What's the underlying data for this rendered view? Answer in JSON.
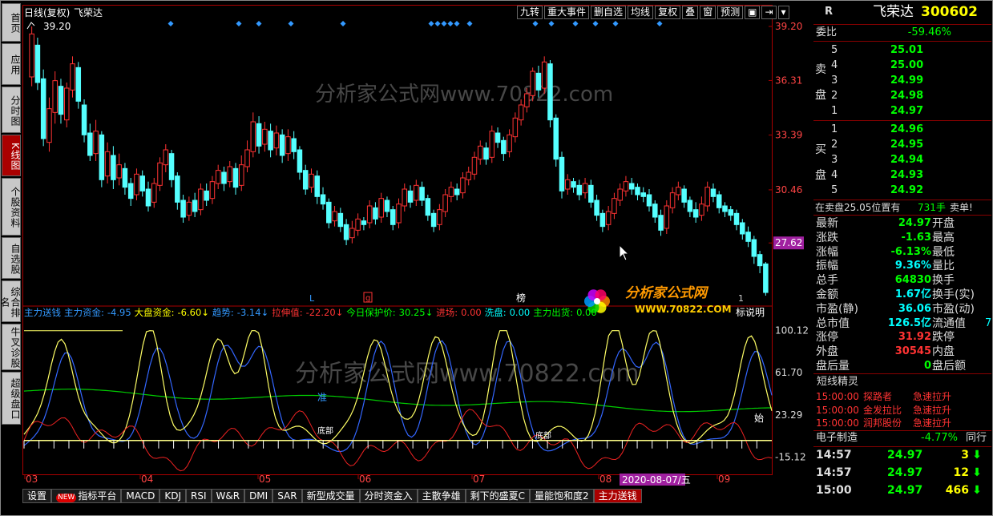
{
  "nav": {
    "items": [
      "首页",
      "应用",
      "分时图",
      "K线图",
      "个股资料",
      "自选股",
      "综合排名",
      "牛叉诊股",
      "超级盘口"
    ]
  },
  "chart_header": {
    "period": "日线(复权)",
    "name": "飞荣达",
    "marker": "39.20"
  },
  "top_buttons": [
    "九转",
    "重大事件",
    "删自选",
    "均线",
    "复权",
    "叠",
    "窗",
    "预测",
    "▣",
    "⇥",
    "▾"
  ],
  "price_axis": [
    "39.20",
    "36.31",
    "33.39",
    "30.46",
    "27.62"
  ],
  "price_tag": "27.62",
  "indicator_axis": [
    "100.12",
    "61.70",
    "23.29",
    "-15.12"
  ],
  "indicator_header": [
    {
      "t": "主力送钱",
      "c": "#39f"
    },
    {
      "t": "主力资金:",
      "c": "#39f"
    },
    {
      "t": "-4.95",
      "c": "#39f"
    },
    {
      "t": "大盘资金:",
      "c": "#ff0"
    },
    {
      "t": "-6.60↓",
      "c": "#ff0"
    },
    {
      "t": "趋势:",
      "c": "#39f"
    },
    {
      "t": "-3.14↓",
      "c": "#39f"
    },
    {
      "t": "拉伸值:",
      "c": "#f33"
    },
    {
      "t": "-22.20↓",
      "c": "#f33"
    },
    {
      "t": "今日保护价:",
      "c": "#0f0"
    },
    {
      "t": "30.25↓",
      "c": "#0f0"
    },
    {
      "t": "进场:",
      "c": "#f33"
    },
    {
      "t": "0.00",
      "c": "#f33"
    },
    {
      "t": "洗盘:",
      "c": "#0ff"
    },
    {
      "t": "0.00",
      "c": "#0ff"
    },
    {
      "t": "主力出货:",
      "c": "#0f0"
    },
    {
      "t": "0.00",
      "c": "#0f0"
    }
  ],
  "indicator_note": "标说明",
  "x_axis": {
    "months": [
      "03",
      "04",
      "05",
      "06",
      "07",
      "08",
      "09"
    ],
    "date_label": "2020-08-07/五"
  },
  "price_markers": {
    "L": "L",
    "g": "g",
    "rank": "榜",
    "count": "1"
  },
  "indicator_labels": {
    "zhun": "准",
    "shi": "始",
    "dibu": "底部"
  },
  "watermark": {
    "main": "分析家公式网www.70822.com",
    "logo": "分析家公式网",
    "logo_url": "WWW.70822.COM"
  },
  "tabs": [
    "设置",
    "指标平台",
    "MACD",
    "KDJ",
    "RSI",
    "W&R",
    "DMI",
    "SAR",
    "新型成交量",
    "分时资金入",
    "主散争雄",
    "剩下的盛夏C",
    "量能饱和度2",
    "主力送钱"
  ],
  "tabs_new": "NEW",
  "active_tab": "主力送钱",
  "quote": {
    "r": "R",
    "name": "飞荣达",
    "code": "300602",
    "weibi_label": "委比",
    "weibi": "-59.46%",
    "sell_label": [
      "卖",
      "盘"
    ],
    "sells": [
      [
        "5",
        "25.01"
      ],
      [
        "4",
        "25.00"
      ],
      [
        "3",
        "24.99"
      ],
      [
        "2",
        "24.98"
      ],
      [
        "1",
        "24.97"
      ]
    ],
    "buy_label": [
      "买",
      "盘"
    ],
    "buys": [
      [
        "1",
        "24.96"
      ],
      [
        "2",
        "24.95"
      ],
      [
        "3",
        "24.94"
      ],
      [
        "4",
        "24.93"
      ],
      [
        "5",
        "24.92"
      ]
    ],
    "notice": "在卖盘25.05位置有",
    "notice_vol": "731手",
    "notice_tail": "卖单!",
    "stats": [
      [
        "最新",
        "24.97",
        "开盘",
        ""
      ],
      [
        "涨跌",
        "-1.63",
        "最高",
        ""
      ],
      [
        "涨幅",
        "-6.13%",
        "最低",
        ""
      ],
      [
        "振幅",
        "9.36%",
        "量比",
        ""
      ],
      [
        "总手",
        "64830",
        "换手",
        ""
      ],
      [
        "金额",
        "1.67亿",
        "换手(实)",
        ""
      ],
      [
        "市盈(静)",
        "36.06",
        "市盈(动)",
        ""
      ],
      [
        "总市值",
        "126.5亿",
        "流通值",
        "7"
      ],
      [
        "涨停",
        "31.92",
        "跌停",
        ""
      ],
      [
        "外盘",
        "30545",
        "内盘",
        ""
      ],
      [
        "盘后量",
        "0",
        "盘后额",
        ""
      ]
    ],
    "sprite_title": "短线精灵",
    "sprites": [
      [
        "15:00:00",
        "探路者",
        "急速拉升"
      ],
      [
        "15:00:00",
        "金发拉比",
        "急速拉升"
      ],
      [
        "15:00:00",
        "润邦股份",
        "急速拉升"
      ]
    ],
    "sector": "电子制造",
    "sector_pct": "-4.77%",
    "sector_more": "同行",
    "ticks": [
      [
        "14:57",
        "24.97",
        "3"
      ],
      [
        "14:57",
        "24.97",
        "12"
      ],
      [
        "15:00",
        "24.97",
        "466"
      ]
    ]
  },
  "chart_data": {
    "type": "candlestick",
    "title": "飞荣达",
    "ylim": [
      24.5,
      39.5
    ],
    "x_months": [
      "03",
      "04",
      "05",
      "06",
      "07",
      "08",
      "09"
    ],
    "candles": [
      [
        36.5,
        38.8,
        36.0,
        39.2
      ],
      [
        38.2,
        36.2,
        35.8,
        38.6
      ],
      [
        36.4,
        33.2,
        32.8,
        36.9
      ],
      [
        33.0,
        34.8,
        32.5,
        35.4
      ],
      [
        34.6,
        36.3,
        34.0,
        36.8
      ],
      [
        36.0,
        34.5,
        34.0,
        36.4
      ],
      [
        34.2,
        35.9,
        33.8,
        36.2
      ],
      [
        35.8,
        37.2,
        35.4,
        37.6
      ],
      [
        37.0,
        35.2,
        34.8,
        37.3
      ],
      [
        35.0,
        33.4,
        33.0,
        35.3
      ],
      [
        33.5,
        32.3,
        32.0,
        34.0
      ],
      [
        32.4,
        33.6,
        32.0,
        34.2
      ],
      [
        33.4,
        31.0,
        30.6,
        33.6
      ],
      [
        31.2,
        32.5,
        30.8,
        33.0
      ],
      [
        32.3,
        31.0,
        30.5,
        32.8
      ],
      [
        31.1,
        31.8,
        30.7,
        32.4
      ],
      [
        31.6,
        30.6,
        30.2,
        31.9
      ],
      [
        30.8,
        30.0,
        29.6,
        31.1
      ],
      [
        30.2,
        31.3,
        29.9,
        31.6
      ],
      [
        31.2,
        30.4,
        30.1,
        31.5
      ],
      [
        30.5,
        29.6,
        29.3,
        30.9
      ],
      [
        29.8,
        30.8,
        29.5,
        31.1
      ],
      [
        30.7,
        31.9,
        30.4,
        32.2
      ],
      [
        31.8,
        32.6,
        31.4,
        32.9
      ],
      [
        32.4,
        31.0,
        30.6,
        32.6
      ],
      [
        31.2,
        29.8,
        29.4,
        31.4
      ],
      [
        29.9,
        29.0,
        28.7,
        30.2
      ],
      [
        29.1,
        29.8,
        28.8,
        30.1
      ],
      [
        29.9,
        29.3,
        29.0,
        30.3
      ],
      [
        29.4,
        30.5,
        29.1,
        30.8
      ],
      [
        30.4,
        29.9,
        29.6,
        30.8
      ],
      [
        30.0,
        30.9,
        29.7,
        31.2
      ],
      [
        30.8,
        31.5,
        30.5,
        31.8
      ],
      [
        31.4,
        30.8,
        30.4,
        31.7
      ],
      [
        30.9,
        31.7,
        30.6,
        32.0
      ],
      [
        31.6,
        30.6,
        30.2,
        31.9
      ],
      [
        30.7,
        31.8,
        30.4,
        32.3
      ],
      [
        31.7,
        32.6,
        31.4,
        33.1
      ],
      [
        32.5,
        34.1,
        32.2,
        34.6
      ],
      [
        34.0,
        32.8,
        32.4,
        34.4
      ],
      [
        32.9,
        33.7,
        32.5,
        34.1
      ],
      [
        33.6,
        32.6,
        32.2,
        34.0
      ],
      [
        32.7,
        33.5,
        32.3,
        33.9
      ],
      [
        33.4,
        32.3,
        31.9,
        33.7
      ],
      [
        32.4,
        33.3,
        32.0,
        33.7
      ],
      [
        33.2,
        32.5,
        32.1,
        33.6
      ],
      [
        32.6,
        31.4,
        31.0,
        32.8
      ],
      [
        31.5,
        30.5,
        30.2,
        31.8
      ],
      [
        30.6,
        31.3,
        30.3,
        31.6
      ],
      [
        31.2,
        30.1,
        29.7,
        31.5
      ],
      [
        30.2,
        29.7,
        29.4,
        30.6
      ],
      [
        29.8,
        28.7,
        28.4,
        30.0
      ],
      [
        28.8,
        29.3,
        28.5,
        29.6
      ],
      [
        29.2,
        28.5,
        28.2,
        29.5
      ],
      [
        28.6,
        27.8,
        27.5,
        28.9
      ],
      [
        27.9,
        28.4,
        27.6,
        28.8
      ],
      [
        28.3,
        28.9,
        28.0,
        29.2
      ],
      [
        28.8,
        28.6,
        28.3,
        29.0
      ],
      [
        28.7,
        29.6,
        28.4,
        29.9
      ],
      [
        29.5,
        28.9,
        28.6,
        29.8
      ],
      [
        29.0,
        30.0,
        28.7,
        30.3
      ],
      [
        29.9,
        29.3,
        29.0,
        30.1
      ],
      [
        29.4,
        28.6,
        28.3,
        29.6
      ],
      [
        28.7,
        29.7,
        28.4,
        30.0
      ],
      [
        29.6,
        30.5,
        29.3,
        30.8
      ],
      [
        30.4,
        29.8,
        29.5,
        30.7
      ],
      [
        29.9,
        30.7,
        29.6,
        31.0
      ],
      [
        30.6,
        29.9,
        29.6,
        30.9
      ],
      [
        30.0,
        29.1,
        28.8,
        30.2
      ],
      [
        29.2,
        28.5,
        28.2,
        29.4
      ],
      [
        28.6,
        29.4,
        28.3,
        29.7
      ],
      [
        29.3,
        30.2,
        29.0,
        30.5
      ],
      [
        30.1,
        30.6,
        29.8,
        30.9
      ],
      [
        30.5,
        30.2,
        29.9,
        30.8
      ],
      [
        30.3,
        31.1,
        30.0,
        31.4
      ],
      [
        31.0,
        31.4,
        30.7,
        31.7
      ],
      [
        31.3,
        32.2,
        31.0,
        32.5
      ],
      [
        32.1,
        32.8,
        31.8,
        33.1
      ],
      [
        32.7,
        32.1,
        31.8,
        33.0
      ],
      [
        32.2,
        33.6,
        31.9,
        33.9
      ],
      [
        33.5,
        33.0,
        32.7,
        33.8
      ],
      [
        33.1,
        32.4,
        32.0,
        33.3
      ],
      [
        32.5,
        33.4,
        32.2,
        33.7
      ],
      [
        33.3,
        34.3,
        33.0,
        34.6
      ],
      [
        34.2,
        35.0,
        33.9,
        35.3
      ],
      [
        34.9,
        35.6,
        34.6,
        35.9
      ],
      [
        35.5,
        36.8,
        35.2,
        37.0
      ],
      [
        36.7,
        35.8,
        35.4,
        37.1
      ],
      [
        35.9,
        37.3,
        35.6,
        37.6
      ],
      [
        37.2,
        34.2,
        33.8,
        37.4
      ],
      [
        34.3,
        32.1,
        31.7,
        34.5
      ],
      [
        32.2,
        30.4,
        30.0,
        32.5
      ],
      [
        30.5,
        31.0,
        30.2,
        31.3
      ],
      [
        30.9,
        30.6,
        30.3,
        31.1
      ],
      [
        30.7,
        30.2,
        29.9,
        31.0
      ],
      [
        30.3,
        30.8,
        30.0,
        31.1
      ],
      [
        30.7,
        29.8,
        29.5,
        31.0
      ],
      [
        29.9,
        29.1,
        28.8,
        30.2
      ],
      [
        29.2,
        28.5,
        28.2,
        29.4
      ],
      [
        28.6,
        29.3,
        28.3,
        29.6
      ],
      [
        29.2,
        30.0,
        28.9,
        30.3
      ],
      [
        29.9,
        30.5,
        29.6,
        30.8
      ],
      [
        30.4,
        30.9,
        30.1,
        31.2
      ],
      [
        30.8,
        30.5,
        30.2,
        31.1
      ],
      [
        30.6,
        30.2,
        29.9,
        30.8
      ],
      [
        30.3,
        30.1,
        29.8,
        30.6
      ],
      [
        30.2,
        29.6,
        29.3,
        30.5
      ],
      [
        29.7,
        29.0,
        28.7,
        29.9
      ],
      [
        29.1,
        28.3,
        28.0,
        29.4
      ],
      [
        28.4,
        29.6,
        28.1,
        29.9
      ],
      [
        29.5,
        30.3,
        29.2,
        30.6
      ],
      [
        30.2,
        30.6,
        29.9,
        30.9
      ],
      [
        30.5,
        29.8,
        29.5,
        30.7
      ],
      [
        29.9,
        29.3,
        29.0,
        30.1
      ],
      [
        29.4,
        29.0,
        28.7,
        29.8
      ],
      [
        29.1,
        29.7,
        28.8,
        30.1
      ],
      [
        29.6,
        30.6,
        29.3,
        30.9
      ],
      [
        30.5,
        30.1,
        29.8,
        30.8
      ],
      [
        30.2,
        29.5,
        29.2,
        30.4
      ],
      [
        29.6,
        29.3,
        29.0,
        29.8
      ],
      [
        29.4,
        29.1,
        28.8,
        29.6
      ],
      [
        29.2,
        28.6,
        28.3,
        29.4
      ],
      [
        28.7,
        28.1,
        27.8,
        28.9
      ],
      [
        28.2,
        27.7,
        27.4,
        28.5
      ],
      [
        27.8,
        26.9,
        26.5,
        28.0
      ],
      [
        27.0,
        26.4,
        26.0,
        27.2
      ],
      [
        26.5,
        24.97,
        24.8,
        26.6
      ]
    ]
  }
}
